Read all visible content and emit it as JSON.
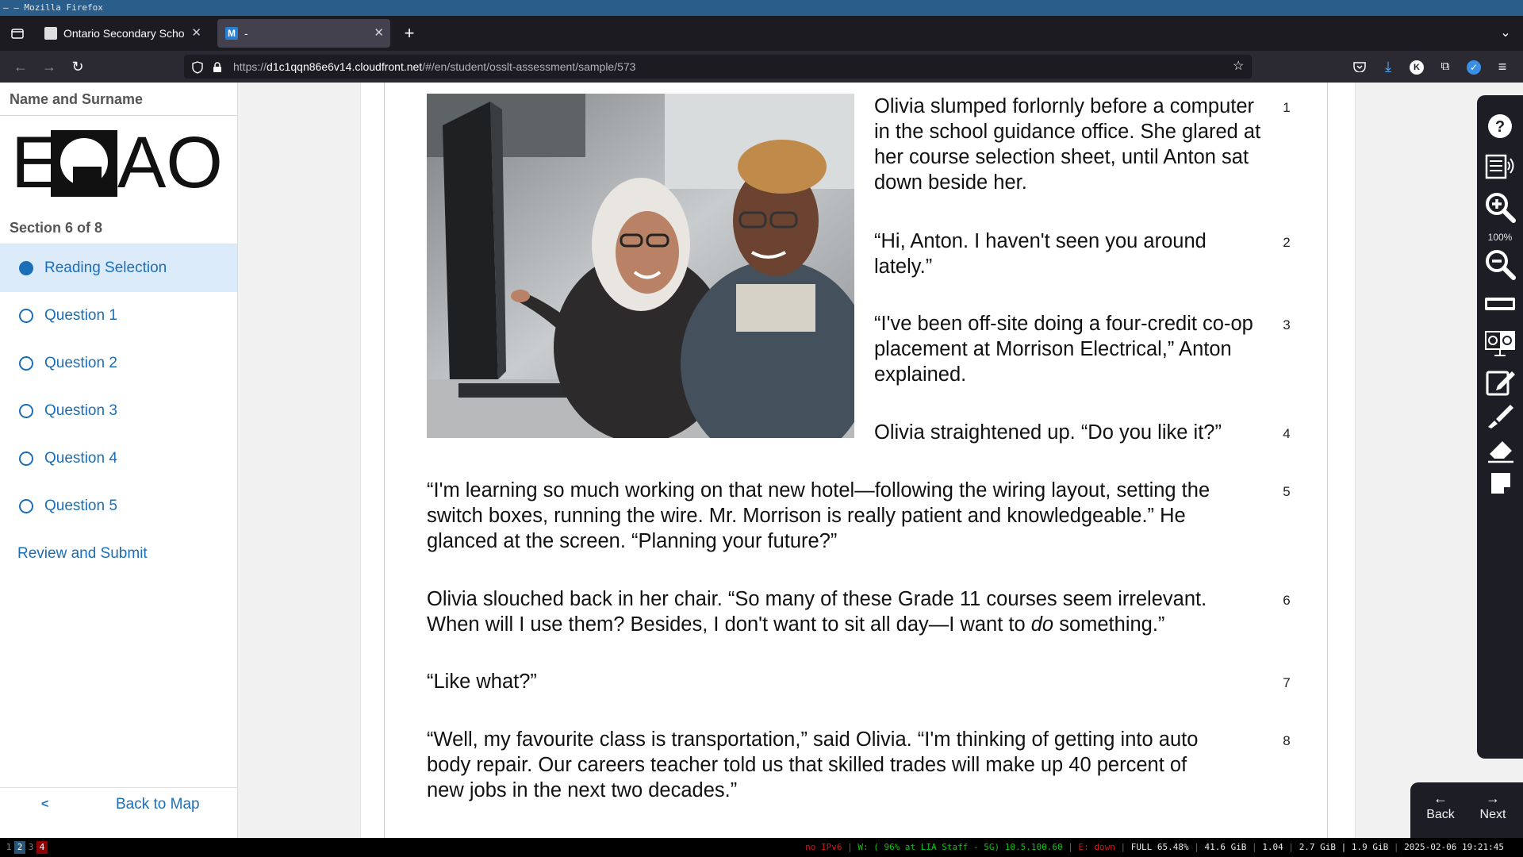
{
  "window_title": "– – Mozilla Firefox",
  "tabs": [
    {
      "label": "Ontario Secondary School Literacy Test",
      "active": false
    },
    {
      "label": "-",
      "active": true
    }
  ],
  "url": {
    "prefix": "https://",
    "host": "d1c1qqn86e6v14.cloudfront.net",
    "path": "/#/en/student/osslt-assessment/sample/573"
  },
  "sidebar": {
    "student_name": "Name and Surname",
    "logo_text": "EQAO",
    "section_label": "Section 6 of 8",
    "items": [
      {
        "label": "Reading Selection",
        "active": true
      },
      {
        "label": "Question 1",
        "active": false
      },
      {
        "label": "Question 2",
        "active": false
      },
      {
        "label": "Question 3",
        "active": false
      },
      {
        "label": "Question 4",
        "active": false
      },
      {
        "label": "Question 5",
        "active": false
      }
    ],
    "review_label": "Review and Submit",
    "back_label": "Back to Map"
  },
  "reading": {
    "paragraphs": [
      {
        "num": "1",
        "text": "Olivia slumped forlornly before a computer in the school guidance office. She glared at her course selection sheet, until Anton sat down beside her."
      },
      {
        "num": "2",
        "text": "“Hi, Anton. I haven't seen you around lately.”"
      },
      {
        "num": "3",
        "text": "“I've been off-site doing a four-credit co-op placement at Morrison Electrical,” Anton explained."
      },
      {
        "num": "4",
        "text": "Olivia straightened up. “Do you like it?”"
      },
      {
        "num": "5",
        "text": "“I'm learning so much working on that new hotel—following the wiring layout, setting the switch boxes, running the wire. Mr. Morrison is really patient and knowledgeable.” He glanced at the screen. “Planning your future?”"
      },
      {
        "num": "6",
        "text_before": "Olivia slouched back in her chair. “So many of these Grade 11 courses seem irrelevant. When will I use them? Besides, I don't want to sit all day—I want to ",
        "text_em": "do",
        "text_after": " something.”"
      },
      {
        "num": "7",
        "text": "“Like what?”"
      },
      {
        "num": "8",
        "text": "“Well, my favourite class is transportation,” said Olivia. “I'm thinking of getting into auto body repair. Our careers teacher told us that skilled trades will make up 40 percent of new jobs in the next two decades.”"
      }
    ]
  },
  "toolbar": {
    "tools": [
      "help-icon",
      "text-to-speech-icon",
      "zoom-in-icon",
      "zoom-out-icon",
      "line-reader-icon",
      "hi-contrast-icon",
      "notepad-icon",
      "highlighter-icon",
      "eraser-icon",
      "sticky-note-icon"
    ],
    "zoom_level": "100%",
    "back_label": "Back",
    "next_label": "Next"
  },
  "statusbar": {
    "workspaces": [
      "1",
      "2",
      "3",
      "4"
    ],
    "ipv6": "no IPv6",
    "wifi": "W: ( 96% at LIA Staff - 5G) 10.5.100.60",
    "ethernet": "E: down",
    "battery": "FULL 65.48%",
    "disk": "41.6 GiB",
    "load": "1.04",
    "mem": "2.7 GiB | 1.9 GiB",
    "datetime": "2025-02-06 19:21:45"
  },
  "colors": {
    "accent": "#1b6fb8",
    "active_item_bg": "#dcebfa",
    "toolbar_bg": "#1d1d26"
  }
}
